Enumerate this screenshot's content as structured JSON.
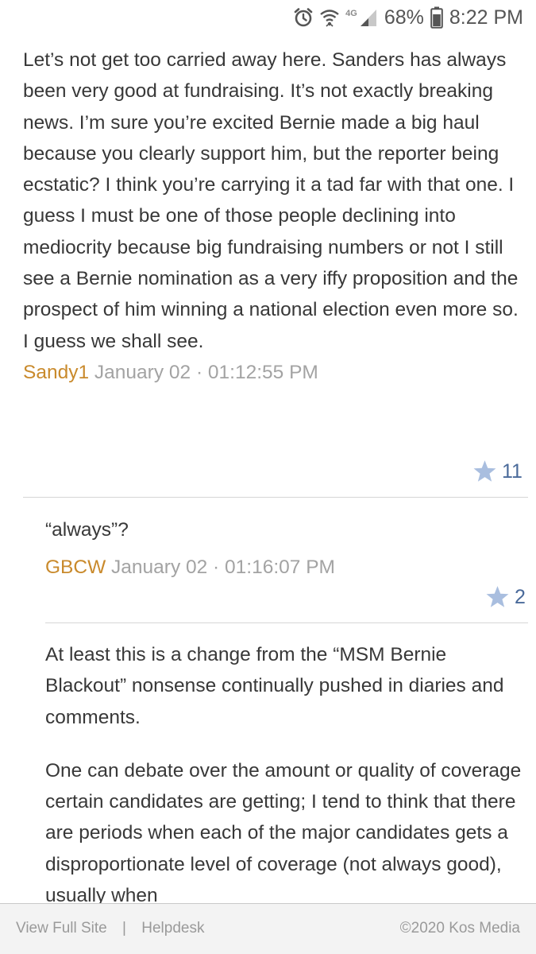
{
  "status_bar": {
    "network_label": "4G",
    "battery": "68%",
    "time": "8:22 PM"
  },
  "comments": [
    {
      "text": "Let’s not get too carried away here. Sanders has always been very good at fundraising. It’s not exactly breaking news. I’m sure you’re excited Bernie made a big haul because you clearly support him, but the reporter being ecstatic? I think you’re carrying it a tad far with that one. I guess I must be one of those people declining into mediocrity because big fundraising numbers or not I still see a Bernie nomination as a very iffy proposition and the prospect of him winning a national election even more so. I guess we shall see.",
      "author": "Sandy1",
      "timestamp": "January 02 · 01:12:55 PM",
      "recommends": "11"
    },
    {
      "text": "“always”?",
      "author": "GBCW",
      "timestamp": "January 02 · 01:16:07 PM",
      "recommends": "2"
    },
    {
      "paragraphs": [
        "At least this is a change from the “MSM Bernie Blackout” nonsense continually pushed in diaries and comments.",
        "One can debate over the amount or quality of coverage certain candidates are getting; I tend to think that there are periods when each of the major candidates gets a disproportionate level of coverage (not always good), usually when"
      ]
    }
  ],
  "footer": {
    "view_full_site": "View Full Site",
    "separator": "|",
    "helpdesk": "Helpdesk",
    "copyright": "©2020 Kos Media"
  },
  "colors": {
    "author": "#c98a2c",
    "meta": "#a3a3a3",
    "star": "#a9bedf",
    "recommend_count": "#4a6a9a",
    "divider": "#d6d6d6",
    "footer_bg": "#f3f3f3"
  }
}
